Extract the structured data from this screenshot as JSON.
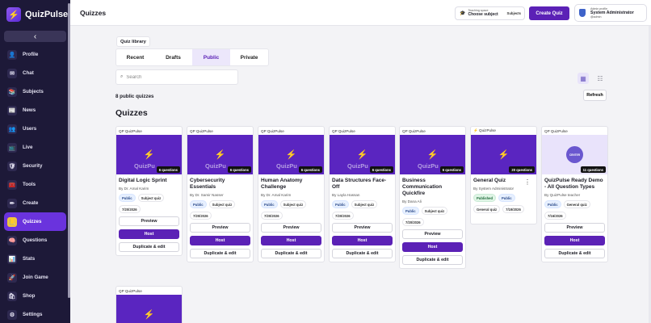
{
  "app": {
    "name": "QuizPulse"
  },
  "sidebar": {
    "collapse_glyph": "‹",
    "items": [
      {
        "label": "Profile",
        "icon": "👤"
      },
      {
        "label": "Chat",
        "icon": "✉"
      },
      {
        "label": "Subjects",
        "icon": "📚"
      },
      {
        "label": "News",
        "icon": "📰"
      },
      {
        "label": "Users",
        "icon": "👥"
      },
      {
        "label": "Live",
        "icon": "📺"
      },
      {
        "label": "Security",
        "icon": "🛡"
      },
      {
        "label": "Tools",
        "icon": "🧰"
      },
      {
        "label": "Create",
        "icon": "✏"
      },
      {
        "label": "Quizzes",
        "icon": "📒"
      },
      {
        "label": "Questions",
        "icon": "🧠"
      },
      {
        "label": "Stats",
        "icon": "📊"
      },
      {
        "label": "Join Game",
        "icon": "🚀"
      },
      {
        "label": "Shop",
        "icon": "🛍"
      },
      {
        "label": "Settings",
        "icon": "⚙"
      }
    ],
    "active_index": 9
  },
  "header": {
    "title": "Quizzes",
    "teaching_space_label": "Teaching space",
    "teaching_space_value": "Choose subject",
    "subjects_label": "Subjects",
    "create_quiz": "Create Quiz",
    "profile_label": "Admin profile",
    "profile_name": "System Administrator",
    "profile_handle": "@admin"
  },
  "library": {
    "label": "Quiz library",
    "tabs": [
      "Recent",
      "Drafts",
      "Public",
      "Private"
    ],
    "active_tab": 2,
    "search_placeholder": "Search",
    "count_text": "8 public quizzes",
    "refresh": "Refresh",
    "section_title": "Quizzes"
  },
  "cards": [
    {
      "source": "QP QuizPulse",
      "watermark": "QuizPu",
      "questions": "6 questions",
      "title": "Digital Logic Sprint",
      "author": "By Dr. Amal Karim",
      "tags": [
        "Public",
        "Subject quiz"
      ],
      "date": "7/20/2026",
      "preview": "Preview",
      "host": "Host",
      "duplicate": "Duplicate & edit"
    },
    {
      "source": "QP QuizPulse",
      "watermark": "QuizPu",
      "questions": "6 questions",
      "title": "Cybersecurity Essentials",
      "author": "By Dr. Samir Nasser",
      "tags": [
        "Public",
        "Subject quiz"
      ],
      "date": "7/20/2026",
      "preview": "Preview",
      "host": "Host",
      "duplicate": "Duplicate & edit"
    },
    {
      "source": "QP QuizPulse",
      "watermark": "QuizPu",
      "questions": "6 questions",
      "title": "Human Anatomy Challenge",
      "author": "By Dr. Amal Karim",
      "tags": [
        "Public",
        "Subject quiz"
      ],
      "date": "7/20/2026",
      "preview": "Preview",
      "host": "Host",
      "duplicate": "Duplicate & edit"
    },
    {
      "source": "QP QuizPulse",
      "watermark": "QuizPu",
      "questions": "6 questions",
      "title": "Data Structures Face-Off",
      "author": "By Layla Hassan",
      "tags": [
        "Public",
        "Subject quiz"
      ],
      "date": "7/20/2026",
      "preview": "Preview",
      "host": "Host",
      "duplicate": "Duplicate & edit"
    },
    {
      "source": "QP QuizPulse",
      "watermark": "QuizPu",
      "questions": "6 questions",
      "title": "Business Communication Quickfire",
      "author": "By Dana Ali",
      "tags": [
        "Public",
        "Subject quiz"
      ],
      "date": "7/20/2026",
      "preview": "Preview",
      "host": "Host",
      "duplicate": "Duplicate & edit"
    },
    {
      "source": "⚡ QuizPulse",
      "watermark": "",
      "questions": "20 questions",
      "title": "General Quiz",
      "author": "By System Administrator",
      "tags": [
        "Published",
        "Public",
        "General quiz",
        "7/19/2026"
      ],
      "date": "",
      "preview": "",
      "host": "",
      "duplicate": "",
      "menu": "⋮"
    },
    {
      "source": "QP QuizPulse",
      "watermark": "",
      "center_badge": "CENTER",
      "questions": "11 questions",
      "title": "QuizPulse Ready Demo - All Question Types",
      "author": "By QuizPulse teacher",
      "tags": [
        "Public",
        "General quiz"
      ],
      "date": "7/16/2026",
      "preview": "Preview",
      "host": "Host",
      "duplicate": "Duplicate & edit"
    },
    {
      "source": "QP QuizPulse"
    }
  ],
  "icons": {
    "bolt": "⚡",
    "search": "⌕",
    "grid": "▦",
    "list": "☷"
  },
  "colors": {
    "primary": "#5b21b6",
    "sidebar": "#1d1938",
    "accent_yellow": "#f2c53a"
  }
}
